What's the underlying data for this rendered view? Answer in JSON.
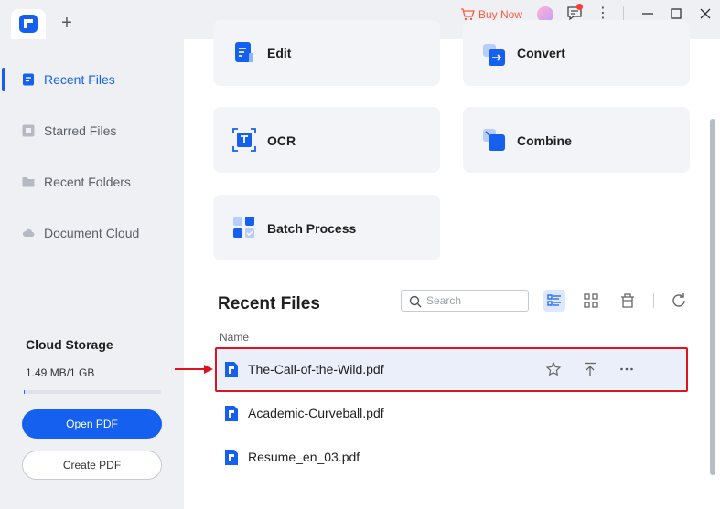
{
  "titlebar": {
    "buy_now": "Buy Now",
    "add_tab": "+"
  },
  "sidebar": {
    "items": [
      {
        "label": "Recent Files",
        "icon": "recent-files-icon",
        "active": true
      },
      {
        "label": "Starred Files",
        "icon": "star-icon",
        "active": false
      },
      {
        "label": "Recent Folders",
        "icon": "folder-icon",
        "active": false
      },
      {
        "label": "Document Cloud",
        "icon": "cloud-icon",
        "active": false
      }
    ],
    "cloud": {
      "title": "Cloud Storage",
      "usage": "1.49 MB/1 GB",
      "used_fraction": 0.0015
    },
    "open_pdf": "Open PDF",
    "create_pdf": "Create PDF"
  },
  "tools": [
    {
      "label": "Edit",
      "icon": "edit-icon"
    },
    {
      "label": "Convert",
      "icon": "convert-icon"
    },
    {
      "label": "OCR",
      "icon": "ocr-icon"
    },
    {
      "label": "Combine",
      "icon": "combine-icon"
    },
    {
      "label": "Batch Process",
      "icon": "batch-process-icon"
    }
  ],
  "recent": {
    "title": "Recent Files",
    "search_placeholder": "Search",
    "column_name": "Name",
    "files": [
      {
        "name": "The-Call-of-the-Wild.pdf",
        "highlighted": true
      },
      {
        "name": "Academic-Curveball.pdf",
        "highlighted": false
      },
      {
        "name": "Resume_en_03.pdf",
        "highlighted": false
      }
    ]
  },
  "colors": {
    "accent": "#1660ef",
    "buy_now": "#ff5a3c",
    "annotation_red": "#e0121f"
  }
}
